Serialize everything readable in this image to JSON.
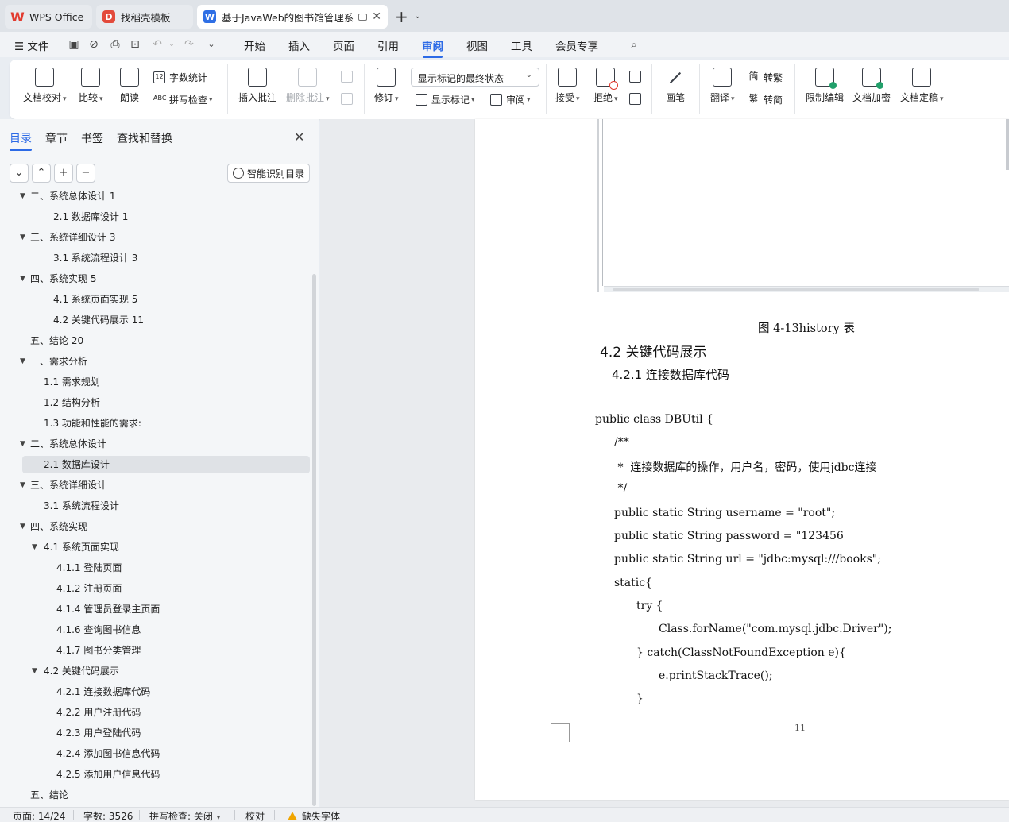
{
  "tabs": [
    {
      "label": "WPS Office",
      "icon": "wps-logo-icon"
    },
    {
      "label": "找稻壳模板",
      "icon": "docer-icon"
    },
    {
      "label": "基于JavaWeb的图书馆管理系",
      "icon": "writer-doc-icon"
    }
  ],
  "menu": {
    "file": "文件",
    "items": [
      "开始",
      "插入",
      "页面",
      "引用",
      "审阅",
      "视图",
      "工具",
      "会员专享"
    ],
    "active": "审阅"
  },
  "ribbon": {
    "proofread": "文档校对",
    "compare": "比较",
    "read_aloud": "朗读",
    "word_count": "字数统计",
    "spell_check": "拼写检查",
    "insert_comment": "插入批注",
    "delete_comment": "删除批注",
    "revise": "修订",
    "markup_state": "显示标记的最终状态",
    "show_markup": "显示标记",
    "review": "审阅",
    "accept": "接受",
    "reject": "拒绝",
    "pen": "画笔",
    "translate": "翻译",
    "to_traditional": "转繁",
    "to_simplified": "转简",
    "restrict_edit": "限制编辑",
    "encrypt": "文档加密",
    "finalize": "文档定稿"
  },
  "nav": {
    "tabs": [
      "目录",
      "章节",
      "书签",
      "查找和替换"
    ],
    "smart_toc": "智能识别目录",
    "toc": [
      {
        "text": "二、系统总体设计 1",
        "level": 1,
        "arrow": true
      },
      {
        "text": "2.1  数据库设计  1",
        "level": 2,
        "arrow": false
      },
      {
        "text": "三、系统详细设计  3",
        "level": 1,
        "arrow": true
      },
      {
        "text": "3.1  系统流程设计  3",
        "level": 2,
        "arrow": false
      },
      {
        "text": "四、系统实现  5",
        "level": 1,
        "arrow": true
      },
      {
        "text": "4.1  系统页面实现  5",
        "level": 2,
        "arrow": false
      },
      {
        "text": "4.2  关键代码展示  11",
        "level": 2,
        "arrow": false
      },
      {
        "text": "五、结论  20",
        "level": 1,
        "arrow": false
      },
      {
        "text": "一、需求分析",
        "level": 1,
        "arrow": true
      },
      {
        "text": "1.1 需求规划",
        "level": 3,
        "arrow": false
      },
      {
        "text": "1.2 结构分析",
        "level": 3,
        "arrow": false
      },
      {
        "text": "1.3 功能和性能的需求:",
        "level": 3,
        "arrow": false
      },
      {
        "text": "二、系统总体设计",
        "level": 1,
        "arrow": true
      },
      {
        "text": "2.1  数据库设计",
        "level": 3,
        "arrow": false,
        "selected": true
      },
      {
        "text": "三、系统详细设计",
        "level": 1,
        "arrow": true
      },
      {
        "text": "3.1  系统流程设计",
        "level": 3,
        "arrow": false
      },
      {
        "text": "四、系统实现",
        "level": 1,
        "arrow": true
      },
      {
        "text": "4.1 系统页面实现",
        "level": 3,
        "arrow": true
      },
      {
        "text": "4.1.1 登陆页面",
        "level": 4,
        "arrow": false
      },
      {
        "text": "4.1.2 注册页面",
        "level": 4,
        "arrow": false
      },
      {
        "text": "4.1.4 管理员登录主页面",
        "level": 4,
        "arrow": false
      },
      {
        "text": "4.1.6 查询图书信息",
        "level": 4,
        "arrow": false
      },
      {
        "text": "4.1.7 图书分类管理",
        "level": 4,
        "arrow": false
      },
      {
        "text": "4.2 关键代码展示",
        "level": 3,
        "arrow": true
      },
      {
        "text": "4.2.1 连接数据库代码",
        "level": 4,
        "arrow": false
      },
      {
        "text": "4.2.2 用户注册代码",
        "level": 4,
        "arrow": false
      },
      {
        "text": "4.2.3 用户登陆代码",
        "level": 4,
        "arrow": false
      },
      {
        "text": "4.2.4 添加图书信息代码",
        "level": 4,
        "arrow": false
      },
      {
        "text": "4.2.5 添加用户信息代码",
        "level": 4,
        "arrow": false
      },
      {
        "text": "五、结论",
        "level": 1,
        "arrow": false
      }
    ]
  },
  "doc": {
    "caption": "图 4-13history 表",
    "heading2": "4.2 关键代码展示",
    "heading3": "4.2.1 连接数据库代码",
    "code": [
      {
        "text": "public class DBUtil {",
        "indent": 0
      },
      {
        "text": "/**",
        "indent": 1
      },
      {
        "text": " *  连接数据库的操作，用户名，密码，使用jdbc连接",
        "indent": 1
      },
      {
        "text": " */",
        "indent": 1
      },
      {
        "text": "public static String username = \"root\";",
        "indent": 1
      },
      {
        "text": "public static String password = \"123456",
        "indent": 1
      },
      {
        "text": "public static String url = \"jdbc:mysql:///books\";",
        "indent": 1
      },
      {
        "text": "static{",
        "indent": 1
      },
      {
        "text": "try {",
        "indent": 2
      },
      {
        "text": "Class.forName(\"com.mysql.jdbc.Driver\");",
        "indent": 3
      },
      {
        "text": "} catch(ClassNotFoundException e){",
        "indent": 2
      },
      {
        "text": "e.printStackTrace();",
        "indent": 3
      },
      {
        "text": "}",
        "indent": 2
      }
    ],
    "page_number": "11"
  },
  "status": {
    "page": "页面: 14/24",
    "words": "字数: 3526",
    "spell": "拼写检查: 关闭",
    "proof": "校对",
    "missing_font": "缺失字体"
  },
  "colors": {
    "accent": "#2c6ae6",
    "wps_red": "#e23b2f",
    "warning": "#f0a500"
  }
}
